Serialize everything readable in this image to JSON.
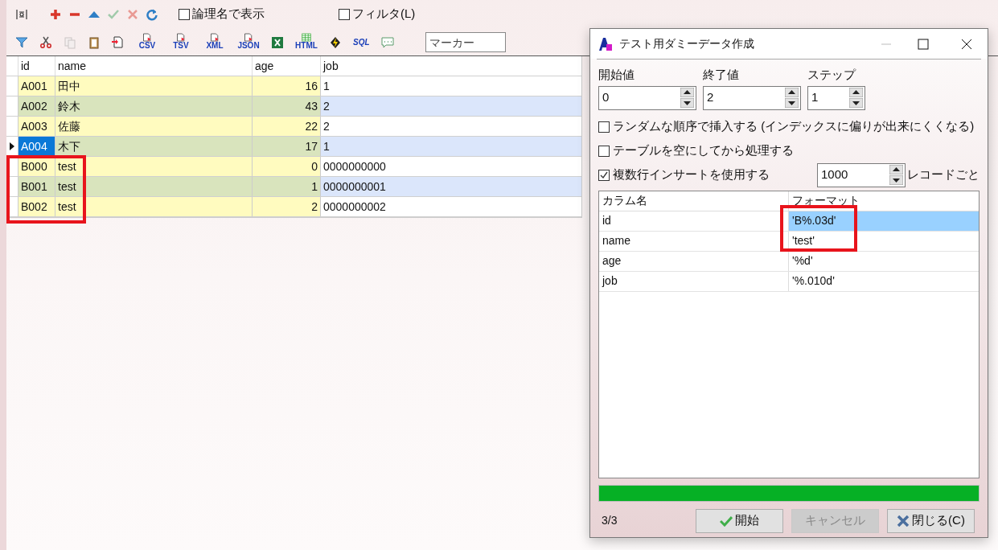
{
  "toolbar1": {
    "buttons": [
      {
        "kind": "fit",
        "disabled": false
      },
      {
        "kind": "add",
        "disabled": false
      },
      {
        "kind": "remove",
        "disabled": false
      },
      {
        "kind": "up",
        "disabled": false
      },
      {
        "kind": "commit",
        "disabled": true
      },
      {
        "kind": "cancel",
        "disabled": true
      },
      {
        "kind": "refresh",
        "disabled": false
      }
    ],
    "checkboxes": [
      {
        "label": "論理名で表示",
        "checked": false
      },
      {
        "label": "フィルタ(L)",
        "checked": false
      }
    ]
  },
  "toolbar2": {
    "buttons": [
      {
        "kind": "filter",
        "disabled": false
      },
      {
        "kind": "cut",
        "disabled": false
      },
      {
        "kind": "copy",
        "disabled": true
      },
      {
        "kind": "paste",
        "disabled": false
      },
      {
        "kind": "import",
        "disabled": false
      },
      {
        "kind": "export",
        "label": "CSV",
        "disabled": false
      },
      {
        "kind": "export",
        "label": "TSV",
        "disabled": false
      },
      {
        "kind": "export",
        "label": "XML",
        "disabled": false
      },
      {
        "kind": "export",
        "label": "JSON",
        "disabled": false
      },
      {
        "kind": "excel",
        "disabled": false
      },
      {
        "kind": "html",
        "label": "HTML",
        "disabled": false
      },
      {
        "kind": "bolt",
        "disabled": false
      },
      {
        "kind": "sql",
        "label": "SQL",
        "disabled": false
      },
      {
        "kind": "comment",
        "disabled": false
      }
    ],
    "marker": {
      "placeholder": "マーカー"
    }
  },
  "grid": {
    "columns": [
      "id",
      "name",
      "age",
      "job"
    ],
    "rows": [
      {
        "cells": [
          "A001",
          "田中",
          "16",
          "1"
        ],
        "selected": false
      },
      {
        "cells": [
          "A002",
          "鈴木",
          "43",
          "2"
        ],
        "selected": false
      },
      {
        "cells": [
          "A003",
          "佐藤",
          "22",
          "2"
        ],
        "selected": false
      },
      {
        "cells": [
          "A004",
          "木下",
          "17",
          "1"
        ],
        "selected": true
      },
      {
        "cells": [
          "B000",
          "test",
          "0",
          "0000000000"
        ],
        "selected": false
      },
      {
        "cells": [
          "B001",
          "test",
          "1",
          "0000000001"
        ],
        "selected": false
      },
      {
        "cells": [
          "B002",
          "test",
          "2",
          "0000000002"
        ],
        "selected": false
      }
    ]
  },
  "dialog": {
    "title": "テスト用ダミーデータ作成",
    "spinners": [
      {
        "label": "開始値",
        "value": "0"
      },
      {
        "label": "終了値",
        "value": "2"
      },
      {
        "label": "ステップ",
        "value": "1"
      }
    ],
    "options": [
      {
        "label": "ランダムな順序で挿入する (インデックスに偏りが出来にくくなる)",
        "checked": false
      },
      {
        "label": "テーブルを空にしてから処理する",
        "checked": false
      },
      {
        "label": "複数行インサートを使用する",
        "checked": true
      }
    ],
    "batch": {
      "value": "1000",
      "suffix": "レコードごと"
    },
    "columns": [
      "カラム名",
      "フォーマット"
    ],
    "rows": [
      {
        "name": "id",
        "format": "'B%.03d'",
        "selected": true
      },
      {
        "name": "name",
        "format": "'test'",
        "selected": false
      },
      {
        "name": "age",
        "format": "'%d'",
        "selected": false
      },
      {
        "name": "job",
        "format": "'%.010d'",
        "selected": false
      }
    ],
    "progress": {
      "level": 1
    },
    "status": "3/3",
    "buttons": [
      {
        "kind": "start",
        "label": "開始",
        "disabled": false
      },
      {
        "kind": "cancel",
        "label": "キャンセル",
        "disabled": true
      },
      {
        "kind": "close",
        "label": "閉じる(C)",
        "disabled": false
      }
    ]
  }
}
